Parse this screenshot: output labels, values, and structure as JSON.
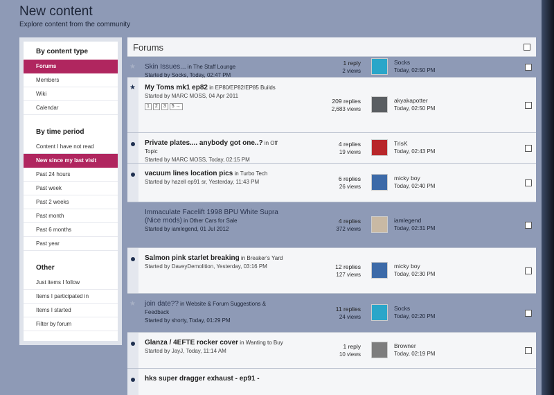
{
  "page": {
    "title": "New content",
    "subtitle": "Explore content from the community"
  },
  "sidebar": {
    "sections": [
      {
        "heading": "By content type",
        "items": [
          {
            "label": "Forums",
            "active": true
          },
          {
            "label": "Members",
            "active": false
          },
          {
            "label": "Wiki",
            "active": false
          },
          {
            "label": "Calendar",
            "active": false
          }
        ]
      },
      {
        "heading": "By time period",
        "items": [
          {
            "label": "Content I have not read",
            "active": false
          },
          {
            "label": "New since my last visit",
            "active": true
          },
          {
            "label": "Past 24 hours",
            "active": false
          },
          {
            "label": "Past week",
            "active": false
          },
          {
            "label": "Past 2 weeks",
            "active": false
          },
          {
            "label": "Past month",
            "active": false
          },
          {
            "label": "Past 6 months",
            "active": false
          },
          {
            "label": "Past year",
            "active": false
          }
        ]
      },
      {
        "heading": "Other",
        "items": [
          {
            "label": "Just items I follow",
            "active": false
          },
          {
            "label": "Items I participated in",
            "active": false
          },
          {
            "label": "Items I started",
            "active": false
          },
          {
            "label": "Filter by forum",
            "active": false
          }
        ]
      }
    ]
  },
  "main": {
    "header": "Forums",
    "topics": [
      {
        "state": "read",
        "marker": "star",
        "title": "Skin Issues...",
        "in_prefix": "in",
        "forum": "The Staff Lounge",
        "meta": "Started by Socks, Today, 02:47 PM",
        "replies": "1 reply",
        "views": "2 views",
        "last_user": "Socks",
        "last_time": "Today, 02:50 PM",
        "avatar_color": "#2aa6c9"
      },
      {
        "state": "unread",
        "marker": "star",
        "title": "My Toms mk1 ep82",
        "in_prefix": "in",
        "forum": "EP80/EP82/EP85 Builds",
        "meta": "Started by MARC MOSS, 04 Apr 2011",
        "pages": [
          "1",
          "2",
          "3",
          "5 →"
        ],
        "replies": "209 replies",
        "views": "2,683 views",
        "last_user": "akyakapotter",
        "last_time": "Today, 02:50 PM",
        "avatar_color": "#5a5e62"
      },
      {
        "state": "unread",
        "marker": "dot",
        "title": "Private plates.... anybody got one..?",
        "in_prefix": "in",
        "forum": "Off Topic",
        "meta": "Started by MARC MOSS, Today, 02:15 PM",
        "replies": "4 replies",
        "views": "19 views",
        "last_user": "TrisK",
        "last_time": "Today, 02:43 PM",
        "avatar_color": "#b8262a"
      },
      {
        "state": "unread",
        "marker": "dot",
        "title": "vacuum lines location pics",
        "in_prefix": "in",
        "forum": "Turbo Tech",
        "meta": "Started by hazell ep91 sr, Yesterday, 11:43 PM",
        "replies": "6 replies",
        "views": "26 views",
        "last_user": "micky boy",
        "last_time": "Today, 02:40 PM",
        "avatar_color": "#3c6aa8"
      },
      {
        "state": "read",
        "marker": "none",
        "title": "Immaculate Facelift 1998 BPU White Supra (Nice mods)",
        "in_prefix": "in",
        "forum": "Other Cars for Sale",
        "meta": "Started by iamlegend, 01 Jul 2012",
        "replies": "4 replies",
        "views": "372 views",
        "last_user": "iamlegend",
        "last_time": "Today, 02:31 PM",
        "avatar_color": "#c9b9a4"
      },
      {
        "state": "unread",
        "marker": "dot",
        "title": "Salmon pink starlet breaking",
        "in_prefix": "in",
        "forum": "Breaker's Yard",
        "meta": "Started by DaveyDemolition, Yesterday, 03:16 PM",
        "replies": "12 replies",
        "views": "127 views",
        "last_user": "micky boy",
        "last_time": "Today, 02:30 PM",
        "avatar_color": "#3c6aa8"
      },
      {
        "state": "read",
        "marker": "star",
        "title": "join date??",
        "in_prefix": "in",
        "forum": "Website & Forum Suggestions & Feedback",
        "meta": "Started by shorty, Today, 01:29 PM",
        "replies": "11 replies",
        "views": "24 views",
        "last_user": "Socks",
        "last_time": "Today, 02:20 PM",
        "avatar_color": "#2aa6c9"
      },
      {
        "state": "unread",
        "marker": "dot",
        "title": "Glanza / 4EFTE rocker cover",
        "in_prefix": "in",
        "forum": "Wanting to Buy",
        "meta": "Started by JayJ, Today, 11:14 AM",
        "replies": "1 reply",
        "views": "10 views",
        "last_user": "Browner",
        "last_time": "Today, 02:19 PM",
        "avatar_color": "#7d7d7d"
      },
      {
        "state": "unread",
        "marker": "dot",
        "title": "hks super dragger exhaust - ep91 -",
        "in_prefix": "",
        "forum": "",
        "meta": "",
        "replies": "",
        "views": "",
        "last_user": "",
        "last_time": "",
        "avatar_color": "#999999"
      }
    ]
  }
}
